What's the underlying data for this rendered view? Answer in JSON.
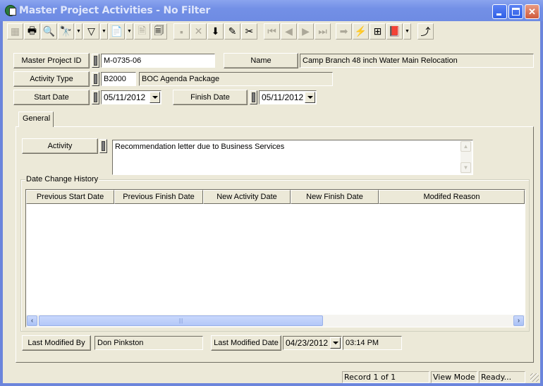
{
  "window": {
    "title": "Master Project Activities - No Filter",
    "controls": [
      "minimize",
      "maximize",
      "close"
    ]
  },
  "toolbar": {
    "buttons": [
      {
        "name": "select-all-icon",
        "glyph": "▦",
        "disabled": true
      },
      {
        "name": "print-icon",
        "glyph": "🖶",
        "disabled": false
      },
      {
        "name": "print-preview-icon",
        "glyph": "🔍",
        "disabled": false
      },
      {
        "name": "find-icon",
        "glyph": "🔭",
        "disabled": false,
        "dropdown": true
      },
      {
        "name": "filter-icon",
        "glyph": "▽",
        "disabled": false,
        "dropdown": true
      },
      {
        "name": "report-icon",
        "glyph": "📄",
        "disabled": false,
        "dropdown": true
      },
      {
        "name": "properties-icon",
        "glyph": "🗎",
        "disabled": true
      },
      {
        "name": "export-icon",
        "glyph": "🗐",
        "disabled": false
      },
      {
        "name": "save-icon",
        "glyph": "▪",
        "disabled": true
      },
      {
        "name": "delete-icon",
        "glyph": "✕",
        "disabled": true
      },
      {
        "name": "add-record-icon",
        "glyph": "⬇",
        "disabled": false
      },
      {
        "name": "edit-icon",
        "glyph": "✎",
        "disabled": false
      },
      {
        "name": "cut-icon",
        "glyph": "✂",
        "disabled": false
      },
      {
        "name": "first-record-icon",
        "glyph": "⏮",
        "disabled": true
      },
      {
        "name": "previous-record-icon",
        "glyph": "◀",
        "disabled": true
      },
      {
        "name": "next-record-icon",
        "glyph": "▶",
        "disabled": true
      },
      {
        "name": "last-record-icon",
        "glyph": "⏭",
        "disabled": true
      },
      {
        "name": "goto-icon",
        "glyph": "➡",
        "disabled": true
      },
      {
        "name": "lightning-icon",
        "glyph": "⚡",
        "disabled": false
      },
      {
        "name": "hierarchy-icon",
        "glyph": "⊞",
        "disabled": false
      },
      {
        "name": "help-book-icon",
        "glyph": "📕",
        "disabled": false,
        "dropdown": true
      },
      {
        "name": "exit-icon",
        "glyph": "⤴",
        "disabled": false
      }
    ]
  },
  "form": {
    "master_project_id_label": "Master Project ID",
    "master_project_id": "M-0735-06",
    "name_label": "Name",
    "name": "Camp Branch 48 inch Water Main Relocation",
    "activity_type_label": "Activity Type",
    "activity_type_code": "B2000",
    "activity_type_desc": "BOC Agenda Package",
    "start_date_label": "Start Date",
    "start_date": "05/11/2012",
    "finish_date_label": "Finish Date",
    "finish_date": "05/11/2012"
  },
  "tabs": [
    {
      "label": "General",
      "active": true
    }
  ],
  "general": {
    "activity_label": "Activity",
    "activity_text": "Recommendation letter due to Business Services",
    "history_title": "Date Change History",
    "history_columns": [
      "Previous Start Date",
      "Previous Finish Date",
      "New Activity Date",
      "New Finish Date",
      "Modifed Reason"
    ],
    "history_rows": [],
    "last_modified_by_label": "Last Modified By",
    "last_modified_by": "Don Pinkston",
    "last_modified_date_label": "Last Modified Date",
    "last_modified_date": "04/23/2012",
    "last_modified_time": "03:14 PM"
  },
  "status": {
    "record": "Record 1 of 1",
    "mode": "View Mode",
    "state": "Ready..."
  }
}
